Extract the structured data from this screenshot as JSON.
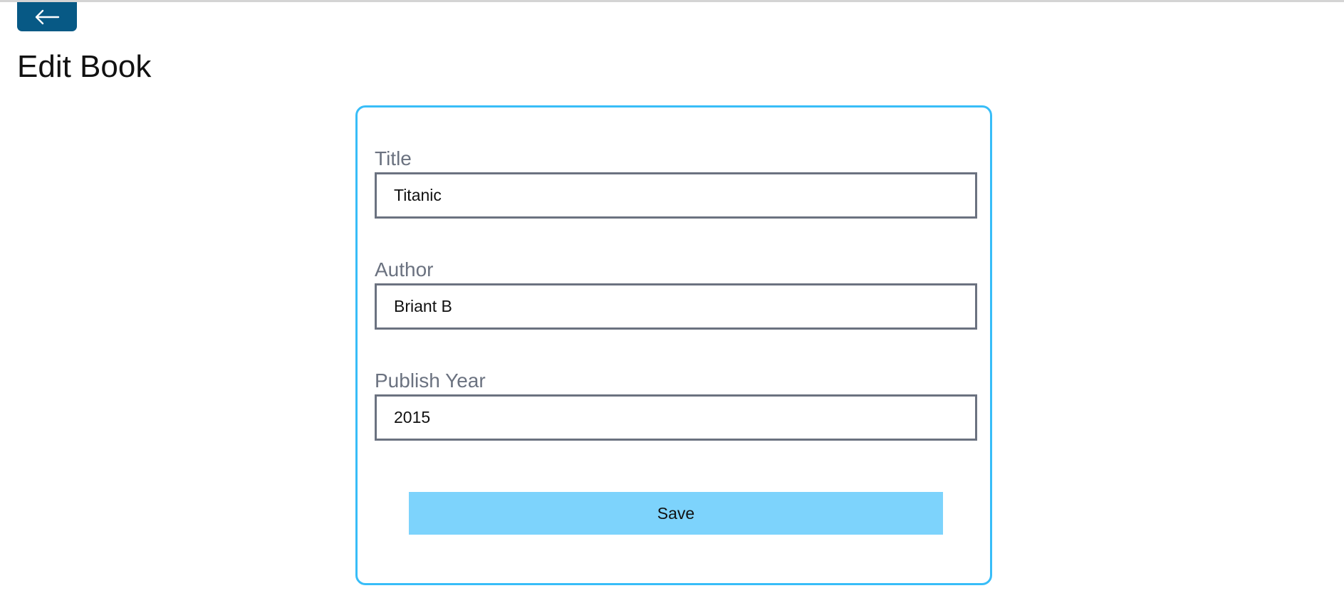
{
  "header": {
    "back_icon": "arrow-left-icon",
    "title": "Edit Book"
  },
  "form": {
    "fields": [
      {
        "label": "Title",
        "value": "Titanic"
      },
      {
        "label": "Author",
        "value": "Briant B"
      },
      {
        "label": "Publish Year",
        "value": "2015"
      }
    ],
    "save_label": "Save"
  },
  "colors": {
    "back_button": "#075985",
    "card_border": "#38bdf8",
    "save_button": "#7dd3fc",
    "label_text": "#6b7280",
    "input_border": "#6b7280"
  }
}
